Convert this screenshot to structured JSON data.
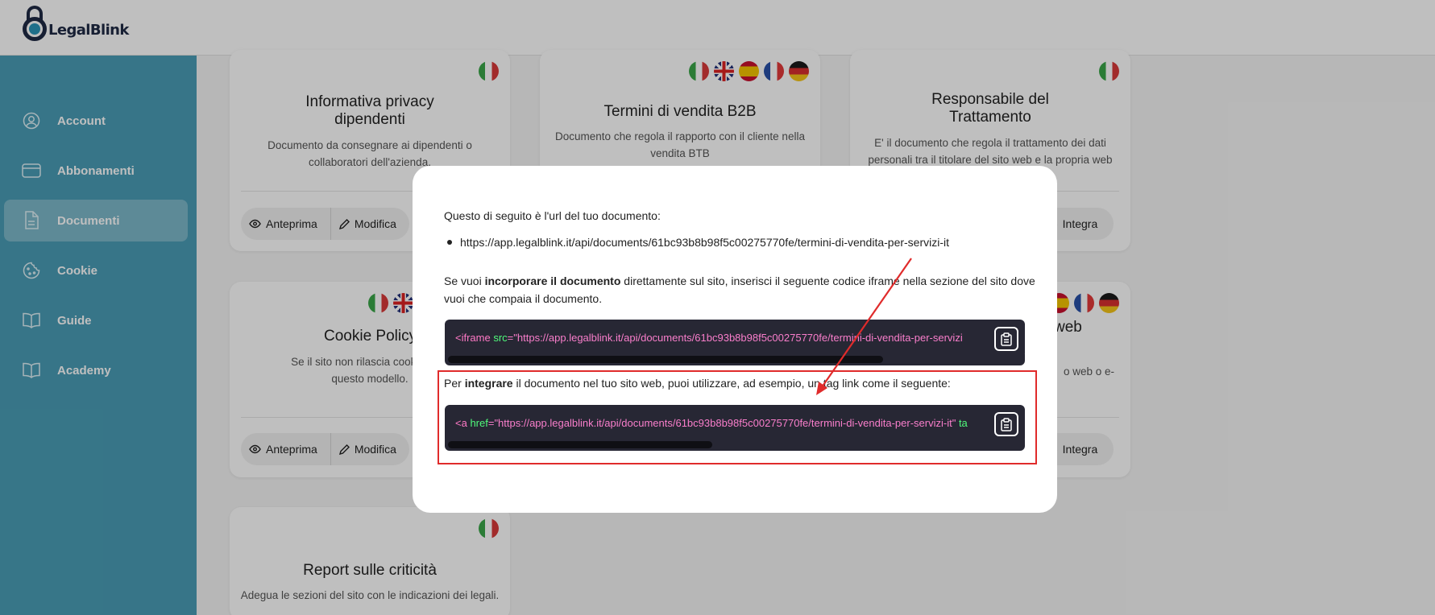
{
  "app": {
    "logo_text": "LegalBlink"
  },
  "sidebar": {
    "items": [
      {
        "label": "Account",
        "icon": "user-circle-icon",
        "active": false
      },
      {
        "label": "Abbonamenti",
        "icon": "credit-card-icon",
        "active": false
      },
      {
        "label": "Documenti",
        "icon": "document-icon",
        "active": true
      },
      {
        "label": "Cookie",
        "icon": "cookie-icon",
        "active": false
      },
      {
        "label": "Guide",
        "icon": "book-icon",
        "active": false
      },
      {
        "label": "Academy",
        "icon": "book-open-icon",
        "active": false
      }
    ]
  },
  "cards": {
    "privacy_dipendenti": {
      "title_line1": "Informativa privacy",
      "title_line2": "dipendenti",
      "desc_line1": "Documento da consegnare ai dipendenti o",
      "desc_line2": "collaboratori dell'azienda.",
      "flags": [
        "it"
      ]
    },
    "termini_b2b": {
      "title": "Termini di vendita B2B",
      "desc_line1": "Documento che regola il rapporto con il cliente nella",
      "desc_line2": "vendita BTB",
      "flags": [
        "it",
        "gb",
        "es",
        "fr",
        "de"
      ]
    },
    "responsabile": {
      "title_line1": "Responsabile del",
      "title_line2": "Trattamento",
      "desc_line1": "E' il documento che regola il trattamento dei dati",
      "desc_line2": "personali tra il titolare del sito web e la propria web",
      "flags": [
        "it"
      ]
    },
    "cookie_policy": {
      "title": "Cookie Policy",
      "desc_line1": "Se il sito non rilascia cookie di pr",
      "desc_line2": "questo modello.",
      "flags": [
        "it",
        "gb"
      ]
    },
    "right_mid": {
      "title_fragment": "web",
      "desc_fragment": "o web o e-",
      "flags": [
        "es",
        "fr",
        "de"
      ]
    },
    "report": {
      "title": "Report sulle criticità",
      "desc_line1": "Adegua le sezioni del sito con le indicazioni dei legali.",
      "flags": [
        "it"
      ]
    },
    "buttons": {
      "anteprima": "Anteprima",
      "modifica": "Modifica",
      "integra": "Integra"
    }
  },
  "modal": {
    "intro": "Questo di seguito è l'url del tuo documento:",
    "url": "https://app.legalblink.it/api/documents/61bc93b8b98f5c00275770fe/termini-di-vendita-per-servizi-it",
    "embed_pre": "Se vuoi ",
    "embed_bold": "incorporare il documento",
    "embed_post": " direttamente sul sito, inserisci il seguente codice iframe nella sezione del sito dove",
    "embed_line2": "vuoi che compaia il documento.",
    "iframe_code": {
      "tag": "<iframe",
      "attr": " src",
      "eq": "=",
      "value": "\"https://app.legalblink.it/api/documents/61bc93b8b98f5c00275770fe/termini-di-vendita-per-servizi"
    },
    "integrate_pre": "Per ",
    "integrate_bold": "integrare",
    "integrate_post": " il documento nel tuo sito web, puoi utilizzare, ad esempio, un tag link come il seguente:",
    "link_code": {
      "tag": "<a",
      "attr": " href",
      "eq": "=",
      "value": "\"https://app.legalblink.it/api/documents/61bc93b8b98f5c00275770fe/termini-di-vendita-per-servizi-it\"",
      "tail": " ta"
    },
    "copy_icon": "clipboard-icon"
  },
  "colors": {
    "sidebar": "#4a9db6",
    "code_bg": "#272734",
    "annotation": "#e02b2b"
  }
}
